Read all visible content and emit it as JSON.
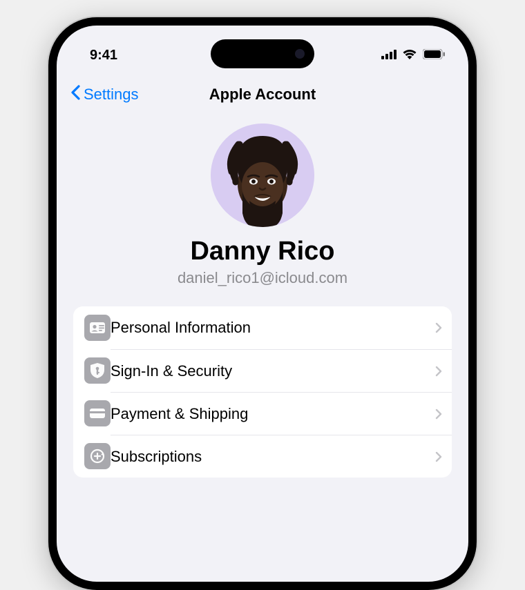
{
  "status": {
    "time": "9:41"
  },
  "nav": {
    "back_label": "Settings",
    "title": "Apple Account"
  },
  "profile": {
    "name": "Danny Rico",
    "email": "daniel_rico1@icloud.com"
  },
  "menu": {
    "items": [
      {
        "label": "Personal Information",
        "icon": "id-card-icon"
      },
      {
        "label": "Sign-In & Security",
        "icon": "shield-key-icon"
      },
      {
        "label": "Payment & Shipping",
        "icon": "credit-card-icon"
      },
      {
        "label": "Subscriptions",
        "icon": "refresh-plus-icon"
      }
    ]
  }
}
